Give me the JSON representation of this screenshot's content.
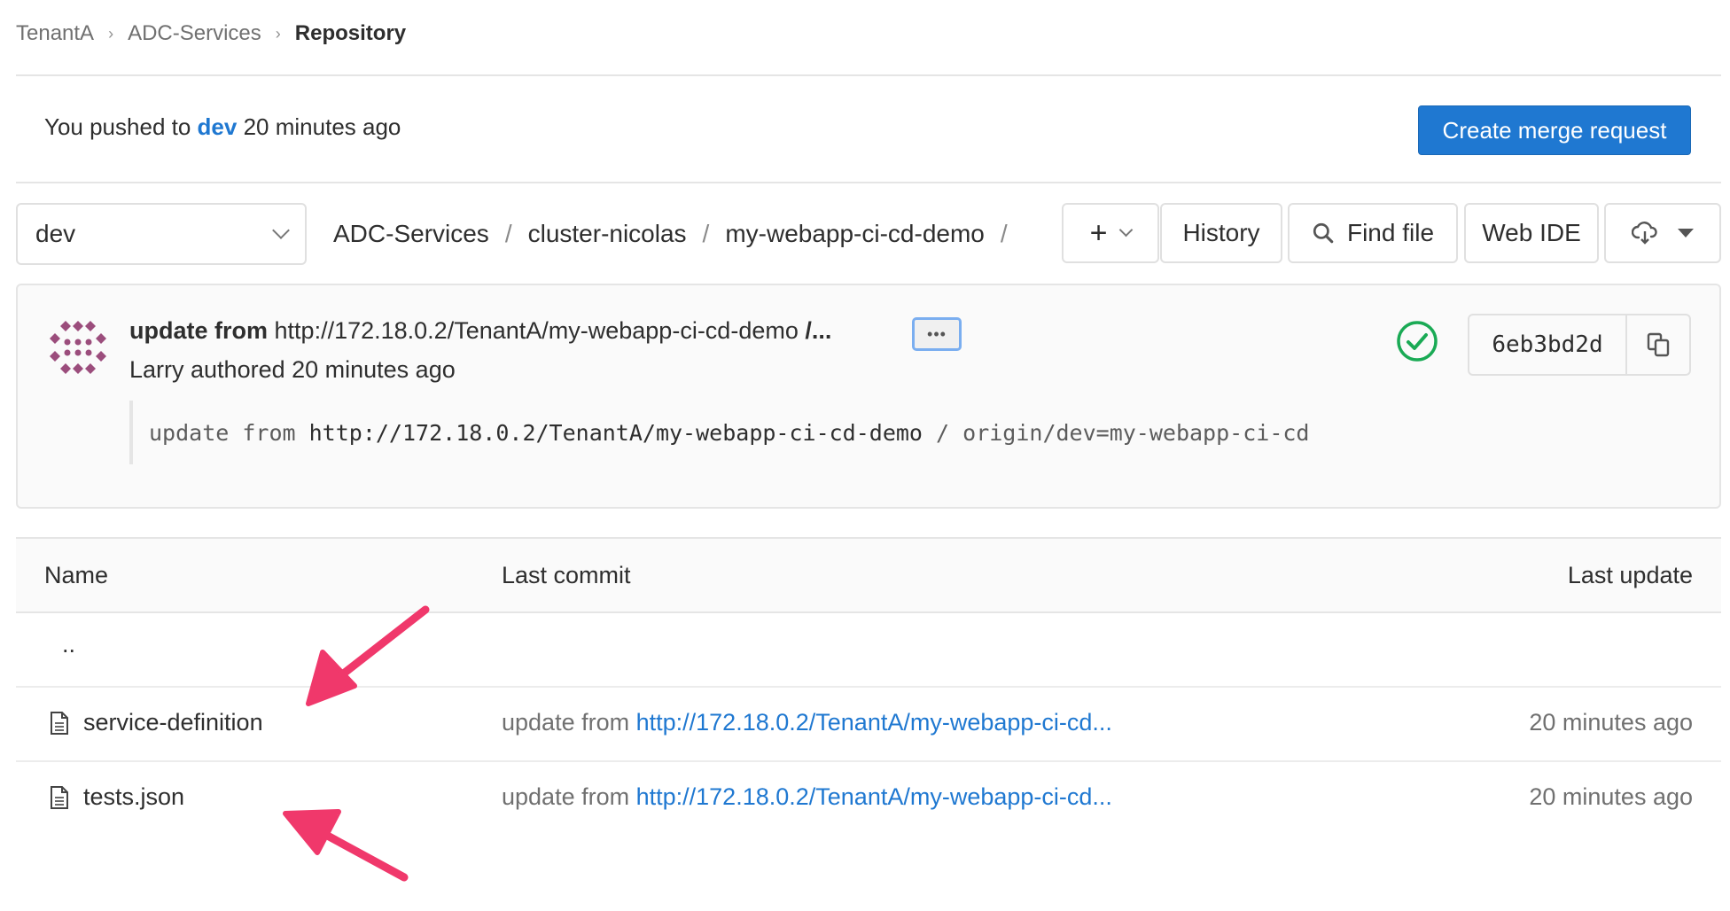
{
  "breadcrumb": {
    "items": [
      "TenantA",
      "ADC-Services",
      "Repository"
    ]
  },
  "push_banner": {
    "prefix": "You pushed to",
    "branch": "dev",
    "suffix": "20 minutes ago",
    "button_label": "Create merge request"
  },
  "toolbar": {
    "branch": "dev",
    "path": [
      "ADC-Services",
      "cluster-nicolas",
      "my-webapp-ci-cd-demo"
    ],
    "path_sep": "/",
    "add_label": "+",
    "history_label": "History",
    "find_file_label": "Find file",
    "web_ide_label": "Web IDE"
  },
  "commit": {
    "title_bold": "update from",
    "title_rest": "http://172.18.0.2/TenantA/my-webapp-ci-cd-demo",
    "title_trail": "/...",
    "more_label": "•••",
    "author": "Larry authored 20 minutes ago",
    "desc_prefix": "update from ",
    "desc_url": "http://172.18.0.2/TenantA/my-webapp-ci-cd-demo",
    "desc_rest": " / origin/dev=my-webapp-ci-cd",
    "sha": "6eb3bd2d"
  },
  "table": {
    "headers": {
      "name": "Name",
      "last_commit": "Last commit",
      "last_update": "Last update"
    },
    "parent": "..",
    "rows": [
      {
        "name": "service-definition",
        "commit_prefix": "update from",
        "commit_link": "http://172.18.0.2/TenantA/my-webapp-ci-cd...",
        "updated": "20 minutes ago"
      },
      {
        "name": "tests.json",
        "commit_prefix": "update from",
        "commit_link": "http://172.18.0.2/TenantA/my-webapp-ci-cd...",
        "updated": "20 minutes ago"
      }
    ]
  },
  "colors": {
    "accent": "#1f78d1",
    "success": "#1aaa55",
    "annotation": "#f0386b",
    "avatar": "#9b4d7c"
  }
}
